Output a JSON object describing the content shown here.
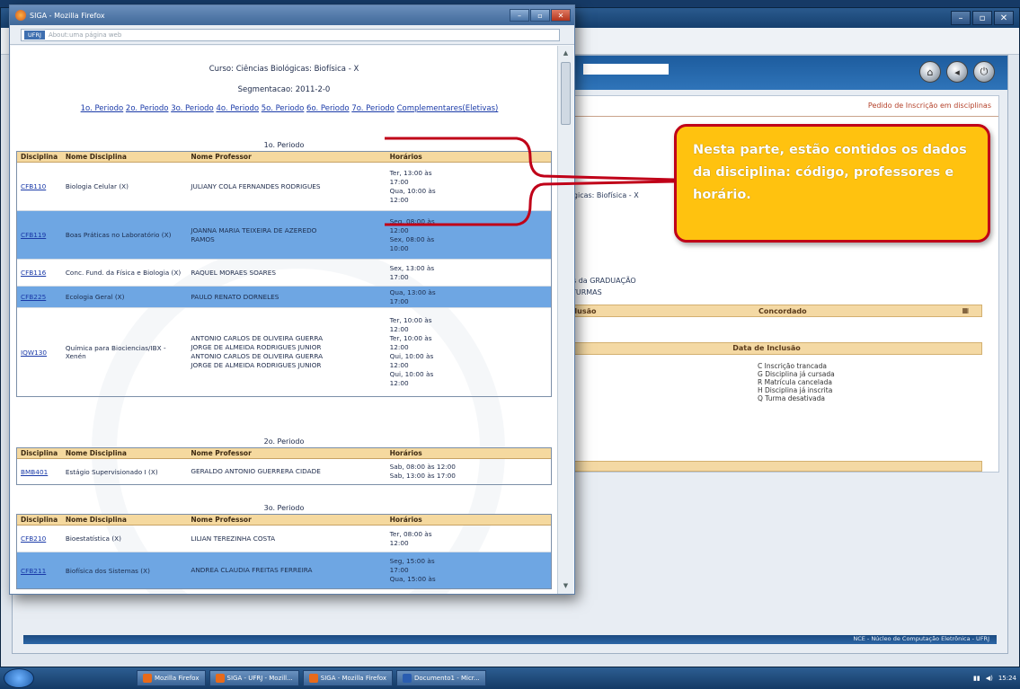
{
  "taskbar": {
    "items": [
      {
        "label": "Mozilla Firefox"
      },
      {
        "label": "SIGA - UFRJ - Mozill..."
      },
      {
        "label": "SIGA - Mozilla Firefox"
      },
      {
        "label": "Documento1 - Micr..."
      }
    ],
    "clock": "15:24"
  },
  "background_window": {
    "header_blank": "",
    "pedido_label": "Pedido de Inscrição em disciplinas",
    "curso_fragment": "ógicas: Biofísica - X",
    "graduacao_fragment": "ases da GRADUAÇÃO",
    "turmas_fragment": "VA TURMAS",
    "bar1_left": "Inclusão",
    "bar1_mid": "Concordado",
    "bar2": "Data de Inclusão",
    "legend": [
      "C Inscrição trancada",
      "G Disciplina já cursada",
      "R Matrícula cancelada",
      "H Disciplina já inscrita",
      "Q Turma desativada"
    ],
    "footer": "NCE - Núcleo de Computação Eletrônica - UFRJ"
  },
  "popup": {
    "title": "SIGA - Mozilla Firefox",
    "address_badge": "UFRJ",
    "address_placeholder": "About:uma página web",
    "curso": "Curso: Ciências Biológicas: Biofísica - X",
    "segmentacao": "Segmentacao: 2011-2-0",
    "period_links": [
      "1o. Periodo",
      "2o. Periodo",
      "3o. Periodo",
      "4o. Periodo",
      "5o. Periodo",
      "6o. Periodo",
      "7o. Periodo",
      "Complementares(Eletivas)"
    ],
    "columns": {
      "code": "Disciplina",
      "name": "Nome Disciplina",
      "prof": "Nome Professor",
      "hours": "Horários"
    },
    "tables": [
      {
        "title": "1o. Periodo",
        "rows": [
          {
            "code": "CFB110",
            "name": "Biologia Celular (X)",
            "prof": [
              "JULIANY COLA FERNANDES RODRIGUES"
            ],
            "hours": [
              "Ter, 13:00 às",
              "17:00",
              "Qua, 10:00 às",
              "12:00"
            ]
          },
          {
            "code": "CFB119",
            "name": "Boas Práticas no Laboratório (X)",
            "prof": [
              "JOANNA MARIA TEIXEIRA DE AZEREDO",
              "RAMOS"
            ],
            "hours": [
              "Seg, 08:00 às",
              "12:00",
              "Sex, 08:00 às",
              "10:00"
            ]
          },
          {
            "code": "CFB116",
            "name": "Conc. Fund. da Física e Biologia (X)",
            "prof": [
              "RAQUEL MORAES SOARES"
            ],
            "hours": [
              "Sex, 13:00 às",
              "17:00"
            ]
          },
          {
            "code": "CFB225",
            "name": "Ecologia Geral (X)",
            "prof": [
              "PAULO RENATO DORNELES"
            ],
            "hours": [
              "Qua, 13:00 às",
              "17:00"
            ]
          },
          {
            "code": "IQW130",
            "name": "Química para Biociencias/IBX - Xenén",
            "prof": [
              "ANTONIO CARLOS DE OLIVEIRA GUERRA",
              "JORGE DE ALMEIDA RODRIGUES JUNIOR",
              "ANTONIO CARLOS DE OLIVEIRA GUERRA",
              "JORGE DE ALMEIDA RODRIGUES JUNIOR"
            ],
            "hours": [
              "Ter, 10:00 às",
              "12:00",
              "Ter, 10:00 às",
              "12:00",
              "Qui, 10:00 às",
              "12:00",
              "Qui, 10:00 às",
              "12:00"
            ]
          }
        ]
      },
      {
        "title": "2o. Periodo",
        "rows": [
          {
            "code": "BMB401",
            "name": "Estágio Supervisionado I (X)",
            "prof": [
              "GERALDO ANTONIO GUERRERA CIDADE"
            ],
            "hours": [
              "Sab, 08:00 às 12:00",
              "Sab, 13:00 às 17:00"
            ]
          }
        ]
      },
      {
        "title": "3o. Periodo",
        "rows": [
          {
            "code": "CFB210",
            "name": "Bioestatística (X)",
            "prof": [
              "LILIAN TEREZINHA COSTA"
            ],
            "hours": [
              "Ter, 08:00 às",
              "12:00"
            ]
          },
          {
            "code": "CFB211",
            "name": "Biofísica dos Sistemas (X)",
            "prof": [
              "ANDREA CLAUDIA FREITAS FERREIRA"
            ],
            "hours": [
              "Seg, 15:00 às",
              "17:00",
              "Qua, 15:00 às"
            ]
          }
        ]
      }
    ]
  },
  "callout": {
    "text": "Nesta parte, estão contidos os dados da disciplina: código, professores e horário."
  },
  "colors": {
    "callout_fill": "#ffc20f",
    "callout_border": "#c00018",
    "header_row": "#f5d99f",
    "alt_row": "#6ea6e3"
  }
}
